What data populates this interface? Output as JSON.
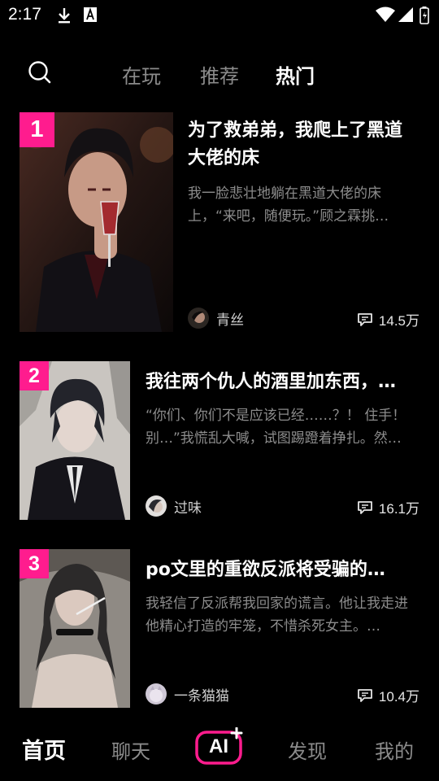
{
  "status_bar": {
    "time": "2:17"
  },
  "top_tabs": [
    {
      "label": "在玩"
    },
    {
      "label": "推荐"
    },
    {
      "label": "热门"
    }
  ],
  "stories": [
    {
      "rank": "1",
      "title": "为了救弟弟，我爬上了黑道大佬的床",
      "description": "我一脸悲壮地躺在黑道大佬的床上，“来吧，随便玩。”顾之霖挑…",
      "author": "青丝",
      "comments": "14.5万"
    },
    {
      "rank": "2",
      "title": "我往两个仇人的酒里加东西，…",
      "description": "“你们、你们不是应该已经……？！ 住手！别…”我慌乱大喊，试图踢蹬着挣扎。然…",
      "author": "过味",
      "comments": "16.1万"
    },
    {
      "rank": "3",
      "title": "po文里的重欲反派将受骗的…",
      "description": "我轻信了反派帮我回家的谎言。他让我走进他精心打造的牢笼，不惜杀死女主。…",
      "author": "一条猫猫",
      "comments": "10.4万"
    }
  ],
  "bottom_nav": {
    "home": "首页",
    "chat": "聊天",
    "ai": "AI",
    "discover": "发现",
    "mine": "我的"
  },
  "colors": {
    "accent": "#ff1c8e",
    "background": "#000000",
    "muted_text": "#8c8c8c"
  }
}
